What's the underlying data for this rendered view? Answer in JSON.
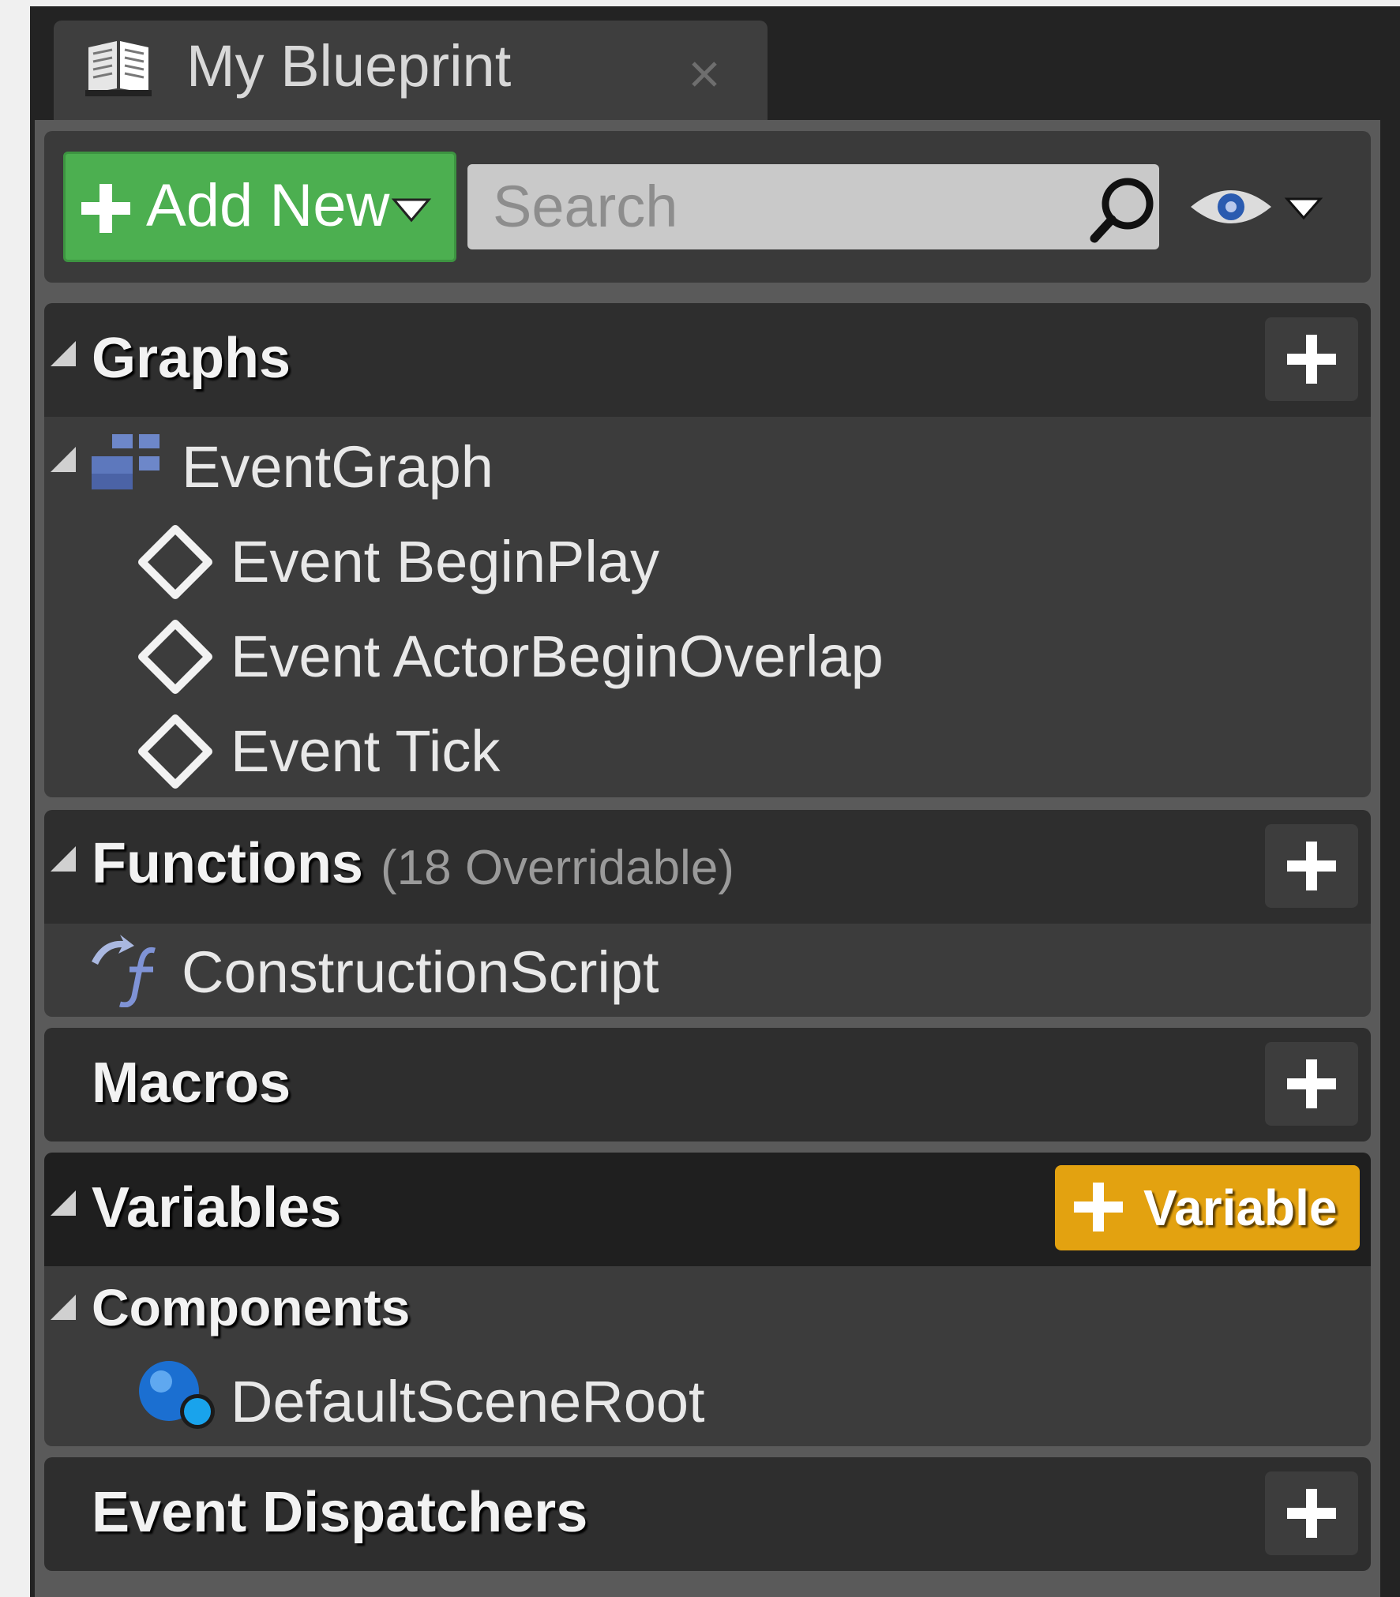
{
  "tab": {
    "title": "My Blueprint"
  },
  "toolbar": {
    "add_new_label": "Add New",
    "search_placeholder": "Search"
  },
  "colors": {
    "add_new": "#4caf50",
    "variable_button": "#e3a210",
    "panel_bg": "#232323",
    "section_header": "#2e2e2e",
    "section_body": "#3c3c3c"
  },
  "sections": {
    "graphs": {
      "title": "Graphs",
      "items": [
        {
          "label": "EventGraph",
          "icon": "event-graph-icon"
        },
        {
          "label": "Event BeginPlay",
          "icon": "event-diamond-icon"
        },
        {
          "label": "Event ActorBeginOverlap",
          "icon": "event-diamond-icon"
        },
        {
          "label": "Event Tick",
          "icon": "event-diamond-icon"
        }
      ]
    },
    "functions": {
      "title": "Functions",
      "overridable": "(18 Overridable)",
      "items": [
        {
          "label": "ConstructionScript",
          "icon": "function-icon"
        }
      ]
    },
    "macros": {
      "title": "Macros"
    },
    "variables": {
      "title": "Variables",
      "add_label": "Variable",
      "categories": [
        {
          "title": "Components",
          "items": [
            {
              "label": "DefaultSceneRoot",
              "icon": "scene-component-icon"
            }
          ]
        }
      ]
    },
    "event_dispatchers": {
      "title": "Event Dispatchers"
    }
  }
}
